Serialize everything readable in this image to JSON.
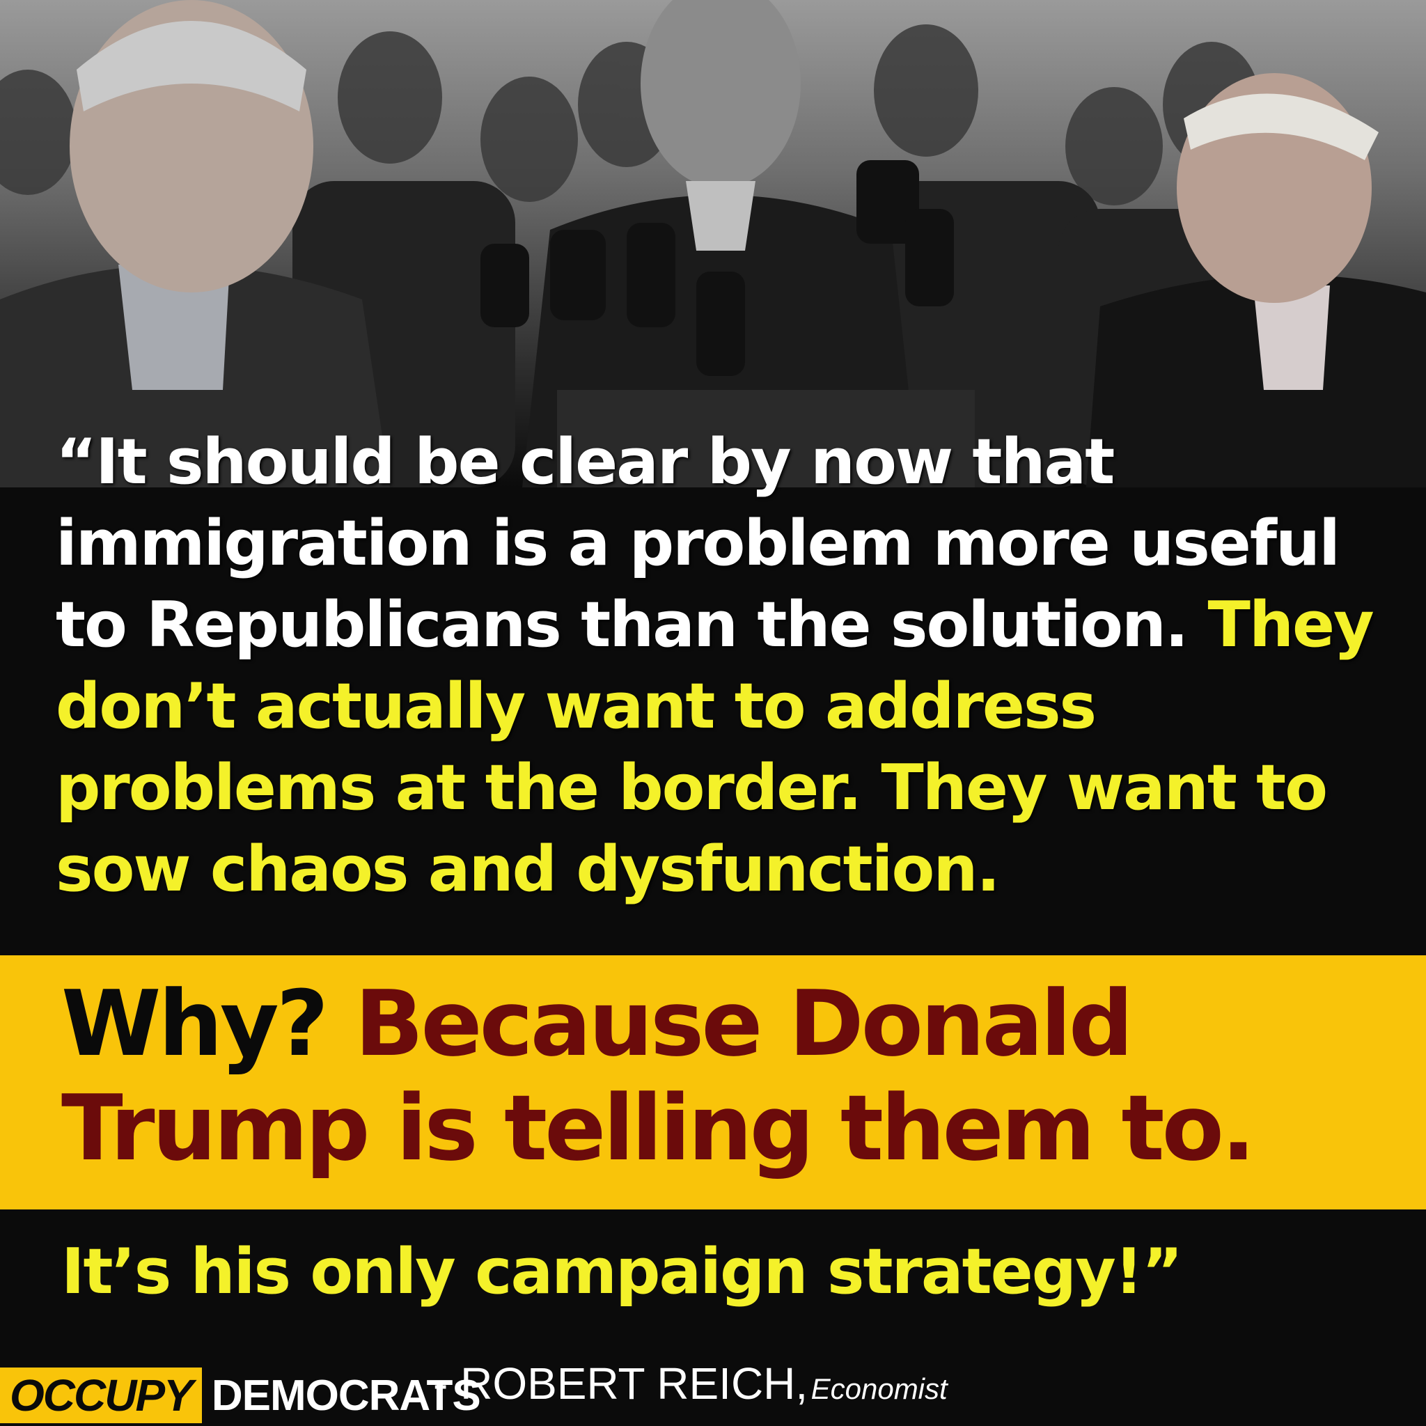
{
  "quote": {
    "white_part": "“It should be clear by now that immigration is a problem more useful to Republicans than the solution.",
    "yellow_part": "They don’t actually want to address problems at the border. They want to sow chaos and dysfunction."
  },
  "band": {
    "why": "Why?",
    "because": "Because Donald Trump is telling them to."
  },
  "closing": "It’s his only campaign strategy!”",
  "attribution": {
    "name": "- ROBERT REICH,",
    "title": "Economist"
  },
  "logo": {
    "occupy": "OCCUPY",
    "democrats": "DEMOCRATS"
  },
  "colors": {
    "yellow_text": "#f4f12a",
    "band": "#f9c40a",
    "maroon": "#6b0b0b",
    "background": "#0b0b0b"
  }
}
